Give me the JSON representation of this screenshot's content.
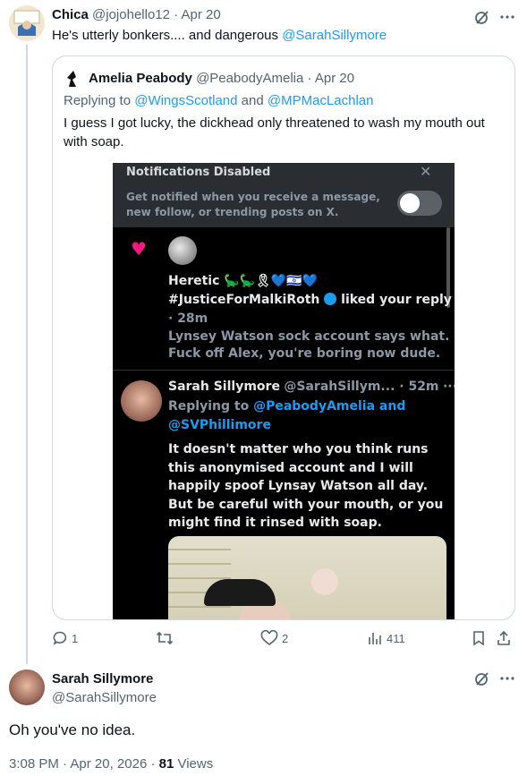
{
  "tweet1": {
    "name": "Chica",
    "handle": "@jojohello12",
    "separator": "·",
    "date": "Apr 20",
    "text": "He's utterly bonkers.... and dangerous ",
    "mention": "@SarahSillymore"
  },
  "quote": {
    "name": "Amelia Peabody",
    "handle": "@PeabodyAmelia",
    "separator": "·",
    "date": "Apr 20",
    "reply_prefix": "Replying to ",
    "reply_mention1": "@WingsScotland",
    "reply_and": " and ",
    "reply_mention2": "@MPMacLachlan",
    "text": "I guess I got lucky, the dickhead only threatened to wash my mouth out with soap."
  },
  "screenshot": {
    "notif_title": "Notifications Disabled",
    "notif_close": "✕",
    "notif_desc": "Get notified when you receive a message, new follow, or trending posts on X.",
    "like_line1": "Heretic 🦕🦕🎗💙🇮🇱💙",
    "like_hashtag": "#JusticeForMalkiRoth",
    "like_action": " liked your reply",
    "like_time": "· 28m",
    "like_text1": "Lynsey Watson sock account says what.",
    "like_text2": "Fuck off Alex, you're boring now dude.",
    "reply_name": "Sarah Sillymore",
    "reply_handle_time": "@SarahSillym... · 52m",
    "reply_more": "···",
    "reply_to_prefix": "Replying to ",
    "reply_to_1": "@PeabodyAmelia",
    "reply_to_and": " and",
    "reply_to_2": "@SVPhillimore",
    "reply_body": "It doesn't matter who you think runs this anonymised account and I will happily spoof Lynsay Watson all day. But be careful with your mouth, or you might find it rinsed with soap."
  },
  "actions": {
    "replies": "1",
    "retweets": "",
    "likes": "2",
    "views": "411"
  },
  "tweet2": {
    "name": "Sarah Sillymore",
    "handle": "@SarahSillymore",
    "text": "Oh you've no idea.",
    "time": "3:08 PM",
    "separator": "·",
    "date": "Apr 20, 2026",
    "views_count": "81",
    "views_label": " Views"
  },
  "colors": {
    "accent": "#1d9bf0",
    "muted": "#536471",
    "text": "#0f1419",
    "like": "#f91880"
  }
}
